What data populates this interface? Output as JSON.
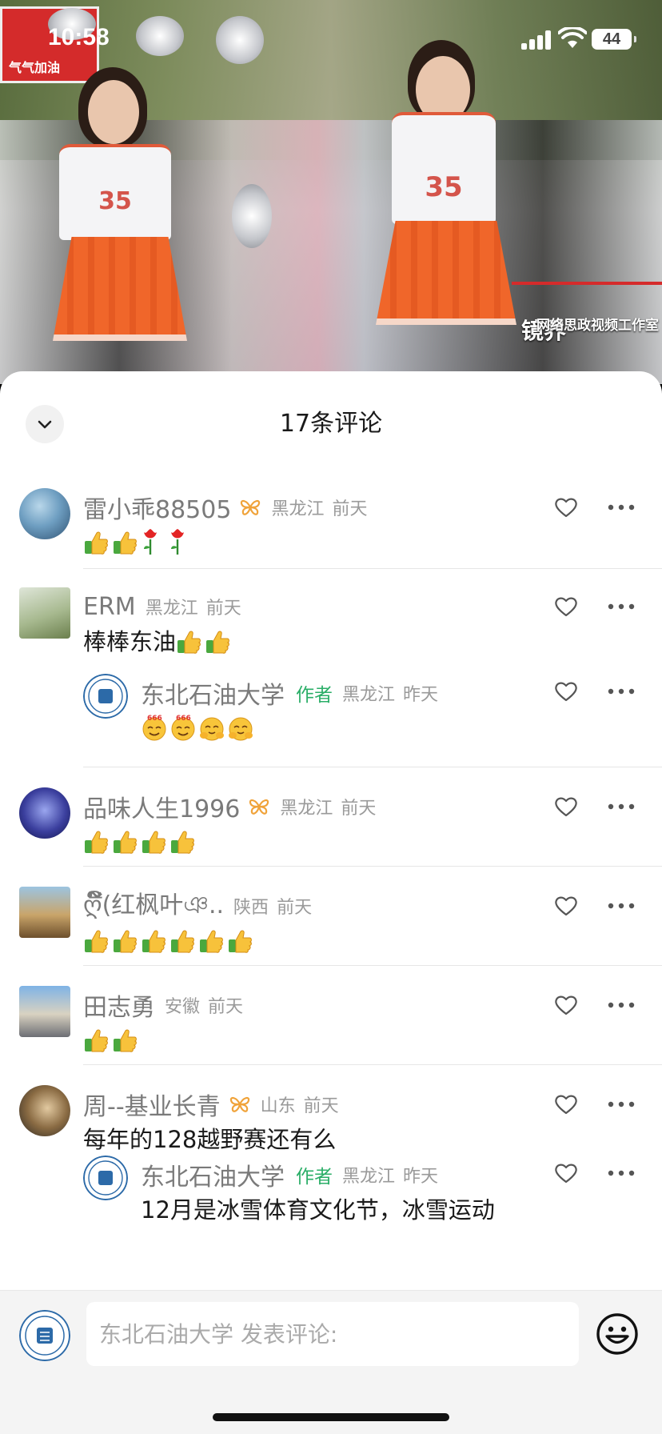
{
  "status_bar": {
    "time": "10:58",
    "battery": "44"
  },
  "video": {
    "shirt_number": "35",
    "sign_text": "气气加油",
    "watermark": "网络思政视频工作室",
    "watermark_logo": "镜界"
  },
  "sheet": {
    "title": "17条评论"
  },
  "comments": [
    {
      "user": "雷小乖88505",
      "badge": true,
      "location": "黑龙江",
      "time": "前天",
      "text": "",
      "emojis": [
        "thumb",
        "thumb",
        "rose",
        "rose"
      ]
    },
    {
      "user": "ERM",
      "badge": false,
      "location": "黑龙江",
      "time": "前天",
      "text": "棒棒东油",
      "emojis": [
        "thumb",
        "thumb"
      ],
      "reply": {
        "user": "东北石油大学",
        "author_tag": "作者",
        "location": "黑龙江",
        "time": "昨天",
        "text": "",
        "emojis": [
          "face666",
          "face666",
          "facehug",
          "facehug"
        ]
      }
    },
    {
      "user": "品味人生1996",
      "badge": true,
      "location": "黑龙江",
      "time": "前天",
      "text": "",
      "emojis": [
        "thumb",
        "thumb",
        "thumb",
        "thumb"
      ]
    },
    {
      "user": "ღ໌້ີ(红枫叶ঞ..",
      "badge": false,
      "location": "陕西",
      "time": "前天",
      "text": "",
      "emojis": [
        "thumb",
        "thumb",
        "thumb",
        "thumb",
        "thumb",
        "thumb"
      ]
    },
    {
      "user": "田志勇",
      "badge": false,
      "location": "安徽",
      "time": "前天",
      "text": "",
      "emojis": [
        "thumb",
        "thumb"
      ]
    },
    {
      "user": "周--基业长青",
      "badge": true,
      "location": "山东",
      "time": "前天",
      "text": "每年的128越野赛还有么",
      "emojis": [],
      "reply": {
        "user": "东北石油大学",
        "author_tag": "作者",
        "location": "黑龙江",
        "time": "昨天",
        "text": "12月是冰雪体育文化节，冰雪运动",
        "emojis": []
      }
    }
  ],
  "input": {
    "placeholder": "东北石油大学 发表评论:"
  },
  "icons": {
    "collapse": "chevron-down-icon",
    "like": "heart-outline-icon",
    "more": "more-dots-icon",
    "badge": "butterfly-badge-icon",
    "emoji": "emoji-smile-icon"
  },
  "colors": {
    "author_tag": "#2aae67",
    "badge": "#f0a33a",
    "secondary_text": "#9a9a9a"
  }
}
